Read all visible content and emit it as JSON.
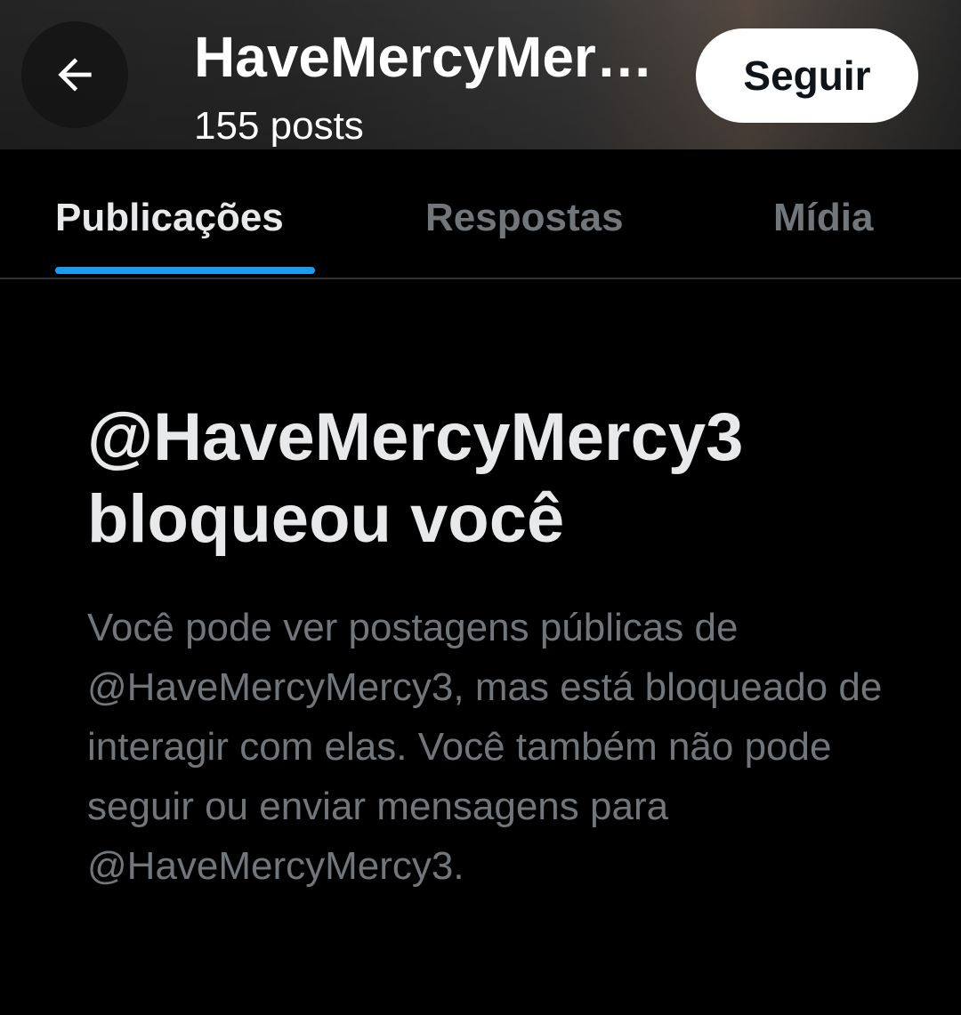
{
  "header": {
    "title": "HaveMercyMer…",
    "posts_count": "155 posts",
    "follow_label": "Seguir",
    "back_icon": "arrow-left-icon"
  },
  "tabs": [
    {
      "label": "Publicações",
      "active": true
    },
    {
      "label": "Respostas",
      "active": false
    },
    {
      "label": "Mídia",
      "active": false
    }
  ],
  "blocked": {
    "title_line1": "@HaveMercyMercy3",
    "title_line2": "bloqueou você",
    "description": "Você pode ver postagens públicas de @HaveMercyMercy3, mas está bloqueado de interagir com elas. Você também não pode seguir ou enviar mensagens para @HaveMercyMercy3."
  },
  "colors": {
    "accent": "#1d9bf0",
    "background": "#000000",
    "primary_text": "#e7e9ea",
    "secondary_text": "#71767b"
  }
}
